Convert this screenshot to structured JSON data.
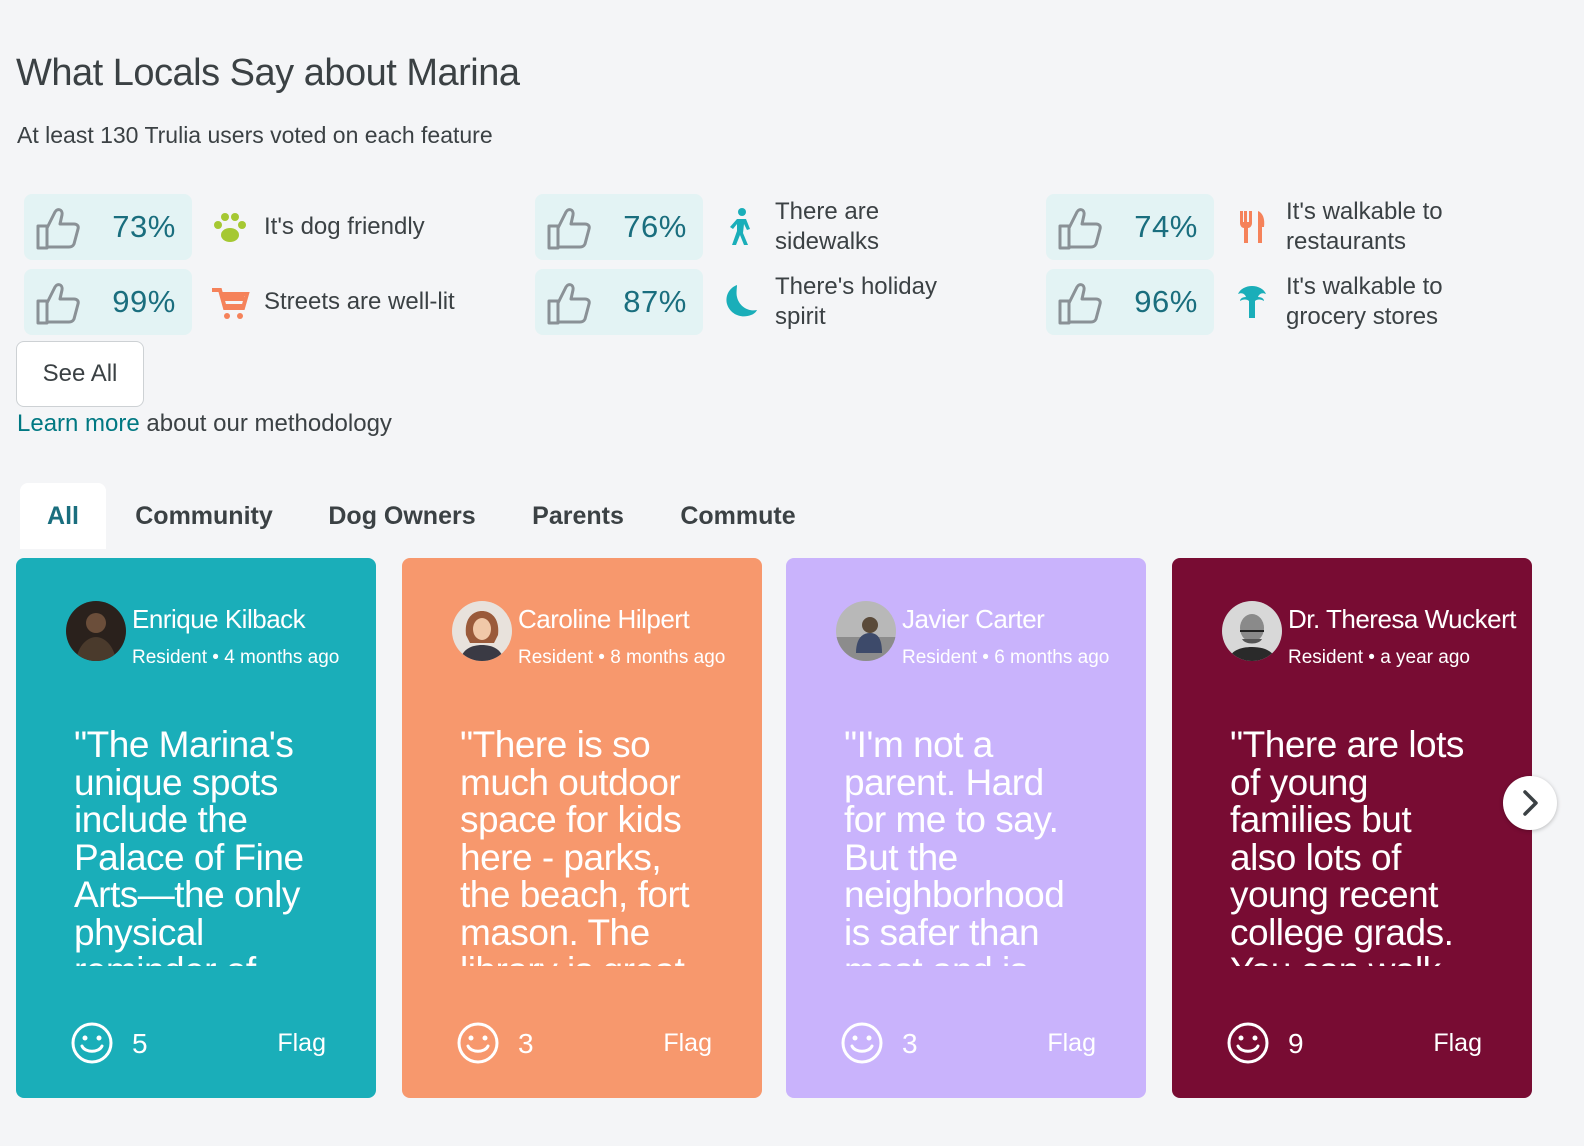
{
  "header": {
    "title": "What Locals Say about Marina",
    "subtitle": "At least 130 Trulia users voted on each feature"
  },
  "colors": {
    "accent": "#007882",
    "badge_bg": "#e3f3f4",
    "percent_text": "#1a6e7e",
    "card_teal": "#1aaeb9",
    "card_orange": "#f7986d",
    "card_purple": "#c9b3fc",
    "card_maroon": "#780c33"
  },
  "stats": [
    {
      "percent": "73%",
      "label": "It's dog friendly",
      "icon": "paw-icon"
    },
    {
      "percent": "76%",
      "label": "There are sidewalks",
      "icon": "pedestrian-icon"
    },
    {
      "percent": "74%",
      "label": "It's walkable to restaurants",
      "icon": "fork-knife-icon"
    },
    {
      "percent": "99%",
      "label": "Streets are well-lit",
      "icon": "cart-icon"
    },
    {
      "percent": "87%",
      "label": "There's holiday spirit",
      "icon": "moon-icon"
    },
    {
      "percent": "96%",
      "label": "It's walkable to grocery stores",
      "icon": "produce-icon"
    }
  ],
  "see_all_label": "See All",
  "methodology": {
    "link_text": "Learn more",
    "rest_text": " about our methodology"
  },
  "tabs": [
    {
      "label": "All",
      "active": true
    },
    {
      "label": "Community",
      "active": false
    },
    {
      "label": "Dog Owners",
      "active": false
    },
    {
      "label": "Parents",
      "active": false
    },
    {
      "label": "Commute",
      "active": false
    }
  ],
  "reviews": [
    {
      "author": "Enrique Kilback",
      "meta": "Resident • 4 months ago",
      "quote": "\"The Marina's unique spots include the Palace of Fine Arts—the only physical reminder of",
      "likes": "5",
      "flag": "Flag",
      "color": "#1aaeb9"
    },
    {
      "author": "Caroline Hilpert",
      "meta": "Resident • 8 months ago",
      "quote": "\"There is so much outdoor space for kids here - parks, the beach, fort mason. The library is great",
      "likes": "3",
      "flag": "Flag",
      "color": "#f7986d"
    },
    {
      "author": "Javier Carter",
      "meta": "Resident • 6 months ago",
      "quote": "\"I'm not a parent. Hard for me to say. But the neighborhood is safer than most and is",
      "likes": "3",
      "flag": "Flag",
      "color": "#c9b3fc"
    },
    {
      "author": "Dr. Theresa Wuckert",
      "meta": "Resident • a year ago",
      "quote": "\"There are lots of young families but also lots of young recent college grads. You can walk",
      "likes": "9",
      "flag": "Flag",
      "color": "#780c33"
    }
  ]
}
